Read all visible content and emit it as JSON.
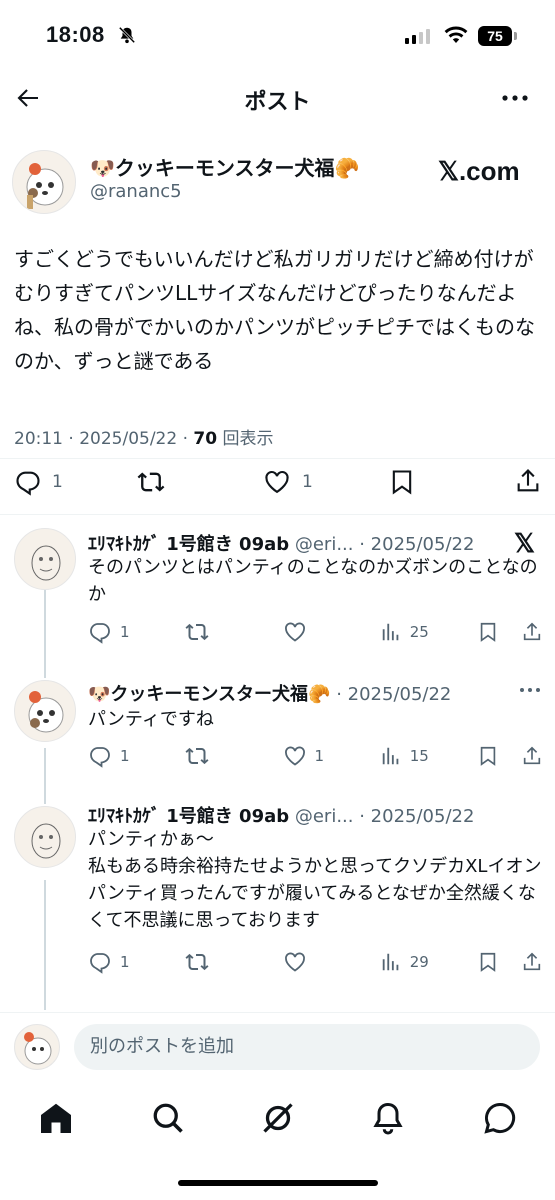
{
  "status_bar": {
    "time": "18:08",
    "battery": "75"
  },
  "header": {
    "title": "ポスト"
  },
  "post": {
    "display_name": "🐶クッキーモンスター犬福🥐",
    "handle": "@rananc5",
    "source_badge": "𝕏.com",
    "text": "すごくどうでもいいんだけど私ガリガリだけど締め付けがむりすぎてパンツLLサイズなんだけどぴったりなんだよね、私の骨がでかいのかパンツがピッチピチではくものなのか、ずっと謎である",
    "time": "20:11 · 2025/05/22 · ",
    "views_count": "70",
    "views_label": " 回表示",
    "reply_count": "1",
    "like_count": "1"
  },
  "replies": [
    {
      "name": "ｴﾘﾏｷﾄｶｹﾞ 1号館き 09ab",
      "handle": " @eri...",
      "date": " · 2025/05/22",
      "text": "そのパンツとはパンティのことなのかズボンのことなのか",
      "reply_count": "1",
      "like_count": "",
      "views": "25"
    },
    {
      "name": "🐶クッキーモンスター犬福🥐",
      "handle": "",
      "date": " · 2025/05/22",
      "text": "パンティですね",
      "reply_count": "1",
      "like_count": "1",
      "views": "15"
    },
    {
      "name": "ｴﾘﾏｷﾄｶｹﾞ 1号館き 09ab",
      "handle": " @eri...",
      "date": " · 2025/05/22",
      "text": "パンティかぁ〜\n私もある時余裕持たせようかと思ってクソデカXLイオンパンティ買ったんですが履いてみるとなぜか全然緩くなくて不思議に思っております",
      "reply_count": "1",
      "like_count": "",
      "views": "29"
    }
  ],
  "compose": {
    "placeholder": "別のポストを追加"
  },
  "icons": {
    "back": "arrow-left-icon",
    "more": "more-horizontal-icon",
    "reply": "reply-icon",
    "repost": "repost-icon",
    "like": "heart-icon",
    "bookmark": "bookmark-icon",
    "share": "share-icon",
    "views": "bar-chart-icon",
    "home": "home-icon",
    "search": "search-icon",
    "grok": "grok-icon",
    "notifications": "bell-icon",
    "messages": "message-icon"
  }
}
